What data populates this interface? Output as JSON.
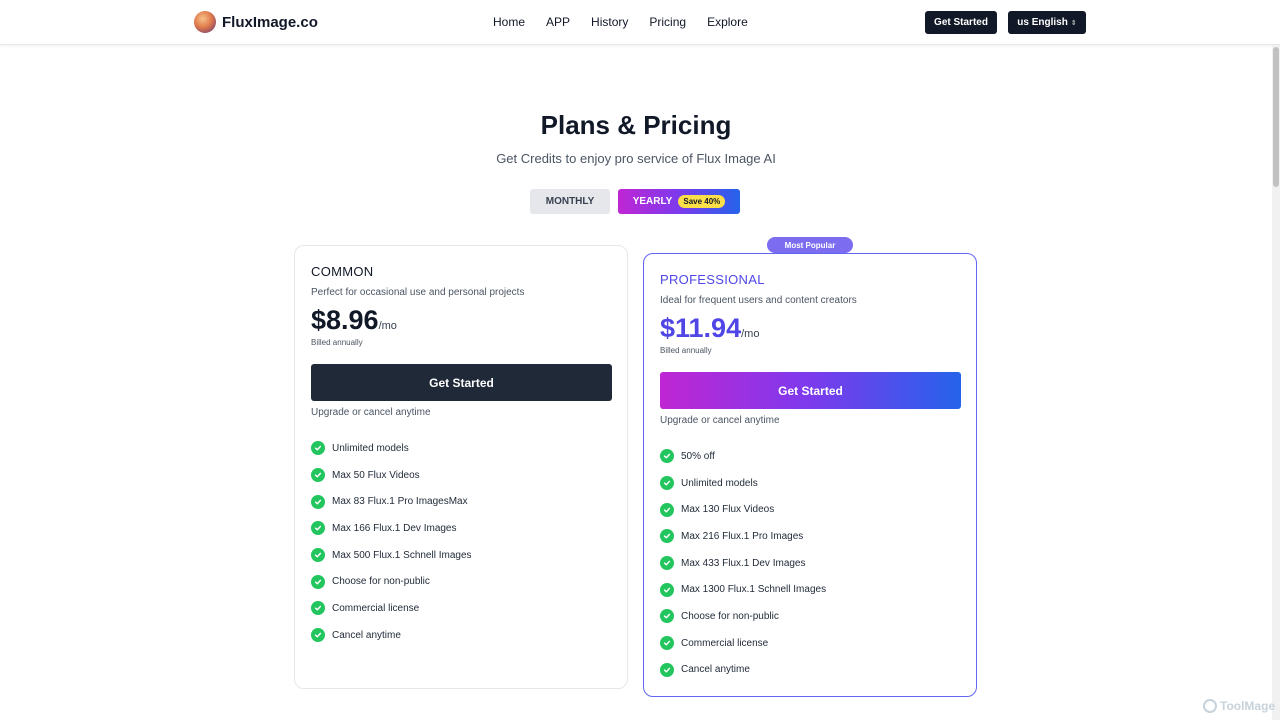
{
  "header": {
    "brand": "FluxImage.co",
    "nav": [
      "Home",
      "APP",
      "History",
      "Pricing",
      "Explore"
    ],
    "get_started": "Get Started",
    "language": "us English"
  },
  "hero": {
    "title": "Plans & Pricing",
    "subtitle": "Get Credits to enjoy pro service of Flux Image AI"
  },
  "billing_toggle": {
    "monthly": "MONTHLY",
    "yearly": "YEARLY",
    "save_badge": "Save 40%",
    "selected": "YEARLY"
  },
  "plans": [
    {
      "name": "COMMON",
      "description": "Perfect for occasional use and personal projects",
      "price": "$8.96",
      "period": "/mo",
      "billed": "Billed annually",
      "cta": "Get Started",
      "note": "Upgrade or cancel anytime",
      "features": [
        "Unlimited models",
        "Max 50 Flux Videos",
        "Max 83 Flux.1 Pro ImagesMax",
        "Max 166 Flux.1 Dev Images",
        "Max 500 Flux.1 Schnell Images",
        "Choose for non-public",
        "Commercial license",
        "Cancel anytime"
      ]
    },
    {
      "name": "PROFESSIONAL",
      "badge": "Most Popular",
      "description": "Ideal for frequent users and content creators",
      "price": "$11.94",
      "period": "/mo",
      "billed": "Billed annually",
      "cta": "Get Started",
      "note": "Upgrade or cancel anytime",
      "features": [
        "50% off",
        "Unlimited models",
        "Max 130 Flux Videos",
        "Max 216 Flux.1 Pro Images",
        "Max 433 Flux.1 Dev Images",
        "Max 1300 Flux.1 Schnell Images",
        "Choose for non-public",
        "Commercial license",
        "Cancel anytime"
      ]
    }
  ],
  "watermark": "ToolMage",
  "colors": {
    "dark": "#111827",
    "accent_purple": "#7c3aed",
    "accent_magenta": "#c026d3",
    "accent_blue": "#2563eb",
    "check_green": "#22c55e",
    "badge_yellow": "#fde047"
  }
}
